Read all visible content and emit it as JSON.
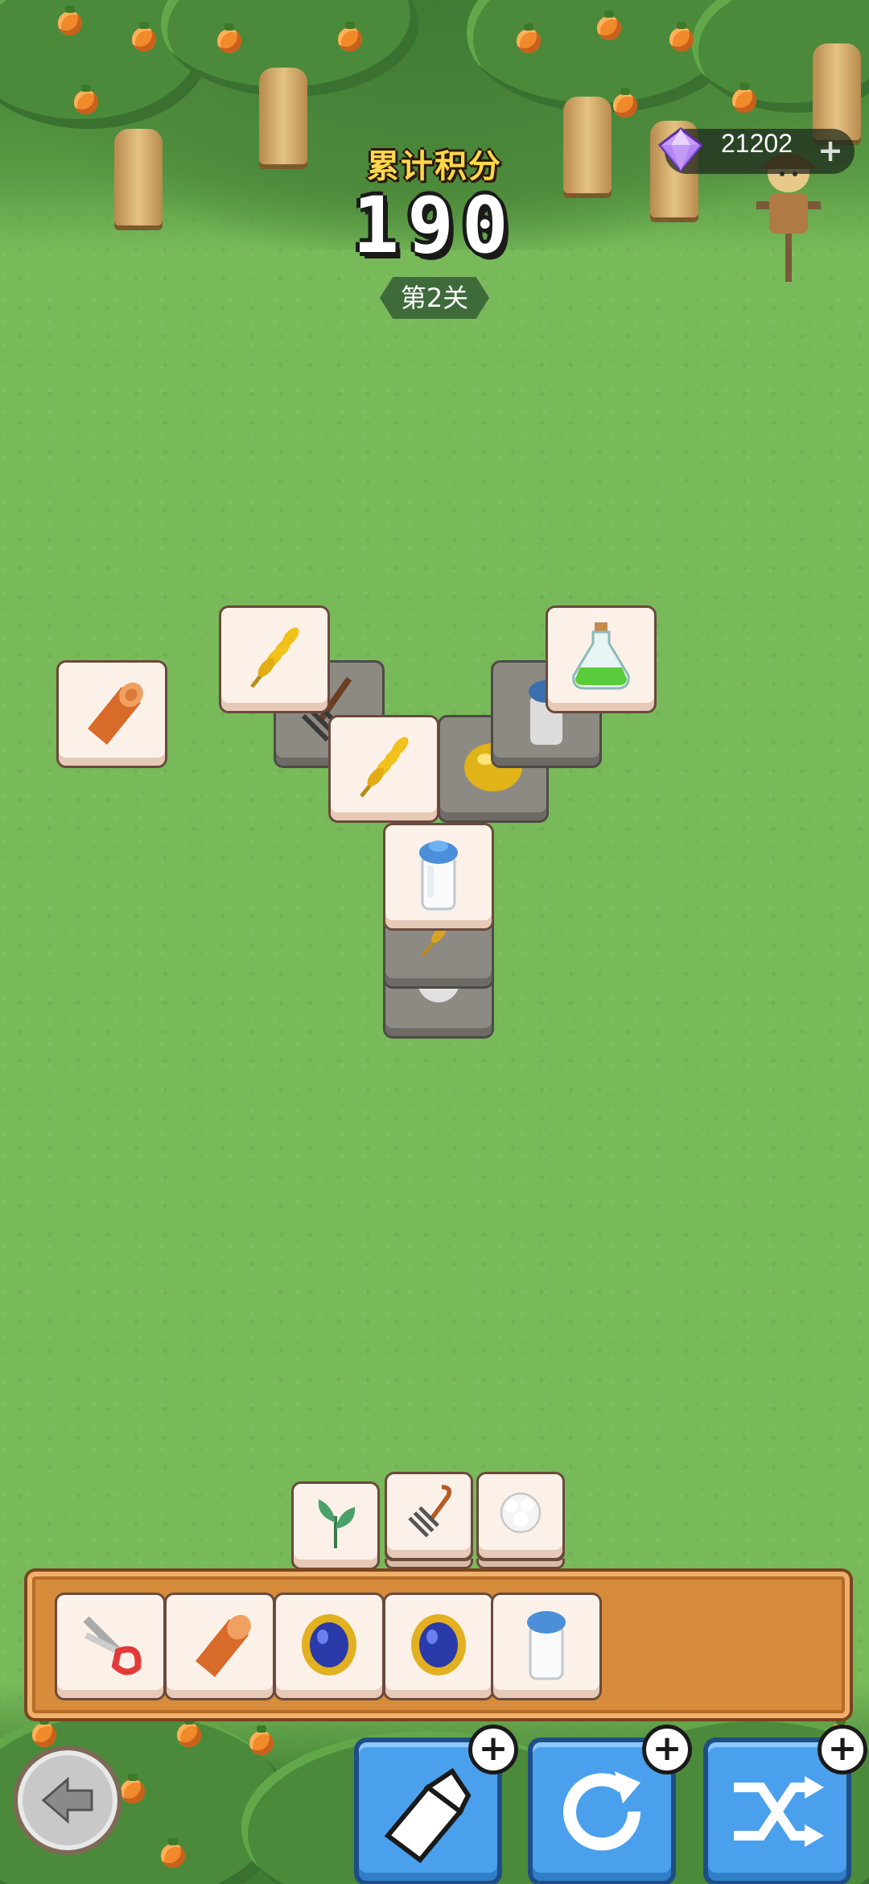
{
  "hud": {
    "score_label": "累计积分",
    "score_value": "190",
    "level_label": "第2关",
    "gems": "21202"
  },
  "colors": {
    "grass": "#78b95a",
    "tray": "#d78c3c",
    "boost": "#4aa0ec",
    "score_label": "#ffd84a"
  },
  "board": {
    "tiles": [
      {
        "icon": "log-icon",
        "state": "selectable"
      },
      {
        "icon": "wheat-icon",
        "state": "selectable"
      },
      {
        "icon": "pitchfork-icon",
        "state": "covered"
      },
      {
        "icon": "wheat-icon",
        "state": "selectable"
      },
      {
        "icon": "lemon-icon",
        "state": "covered"
      },
      {
        "icon": "milk-bottle-icon",
        "state": "covered"
      },
      {
        "icon": "potion-icon",
        "state": "selectable"
      },
      {
        "icon": "milk-bottle-icon",
        "state": "selectable"
      },
      {
        "icon": "wheat-icon",
        "state": "covered"
      },
      {
        "icon": "cotton-icon",
        "state": "covered"
      }
    ],
    "stacks": [
      {
        "icon": "leaf-icon",
        "depth": 1
      },
      {
        "icon": "pitchfork-icon",
        "depth": 2
      },
      {
        "icon": "cotton-icon",
        "depth": 2
      }
    ]
  },
  "tray": {
    "slots": [
      "shears-icon",
      "log-icon",
      "sapphire-ring-icon",
      "sapphire-ring-icon",
      "milk-bottle-icon"
    ],
    "capacity": 7
  },
  "boosters": [
    "undo-icon",
    "refresh-icon",
    "shuffle-icon"
  ]
}
